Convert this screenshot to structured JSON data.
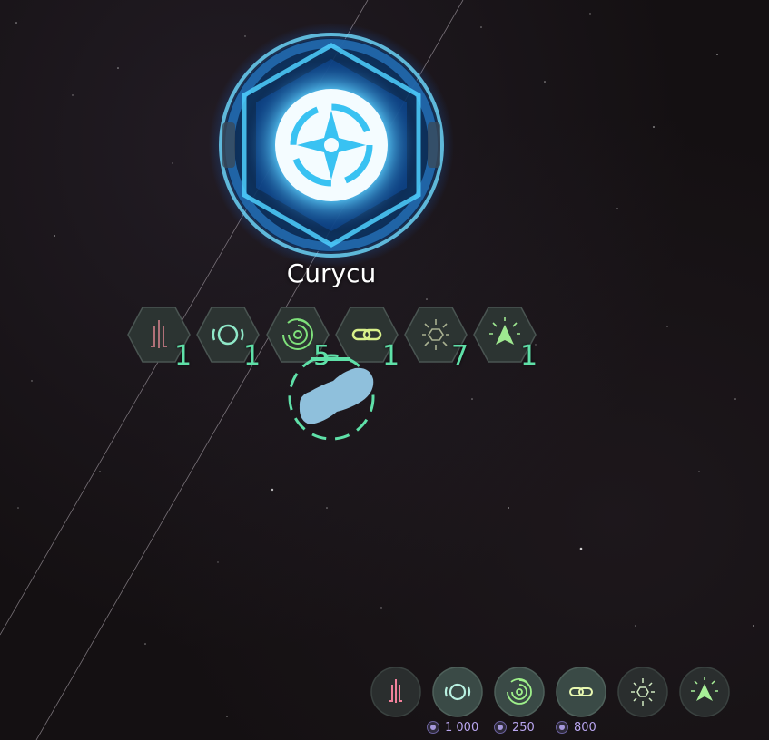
{
  "planet": {
    "name": "Curycu"
  },
  "colors": {
    "accent_green": "#5fe0a8",
    "hex_fill": "#2c3432",
    "gate_glow": "#3ec9ff",
    "cost_text": "#b9a6f0",
    "fleet_fill": "#8fc0dc"
  },
  "modules": [
    {
      "icon": "rocket-icon",
      "count": "1",
      "color": "#b07078"
    },
    {
      "icon": "ring-icon",
      "count": "1",
      "color": "#8fe8c8"
    },
    {
      "icon": "vortex-icon",
      "count": "5",
      "color": "#7ee07a"
    },
    {
      "icon": "link-icon",
      "count": "1",
      "color": "#d8f08a"
    },
    {
      "icon": "burst-hex-icon",
      "count": "7",
      "color": "#a8b090"
    },
    {
      "icon": "ship-burst-icon",
      "count": "1",
      "color": "#9ee890"
    }
  ],
  "build_bar": [
    {
      "icon": "rocket-icon",
      "color": "#f0809a",
      "cost": ""
    },
    {
      "icon": "ring-icon",
      "color": "#b8f0e0",
      "cost": "1 000"
    },
    {
      "icon": "vortex-icon",
      "color": "#9ef08a",
      "cost": "250"
    },
    {
      "icon": "link-icon",
      "color": "#e8f8b0",
      "cost": "800"
    },
    {
      "icon": "burst-hex-icon",
      "color": "#d0e8c0",
      "cost": ""
    },
    {
      "icon": "ship-burst-icon",
      "color": "#a8f098",
      "cost": ""
    }
  ]
}
